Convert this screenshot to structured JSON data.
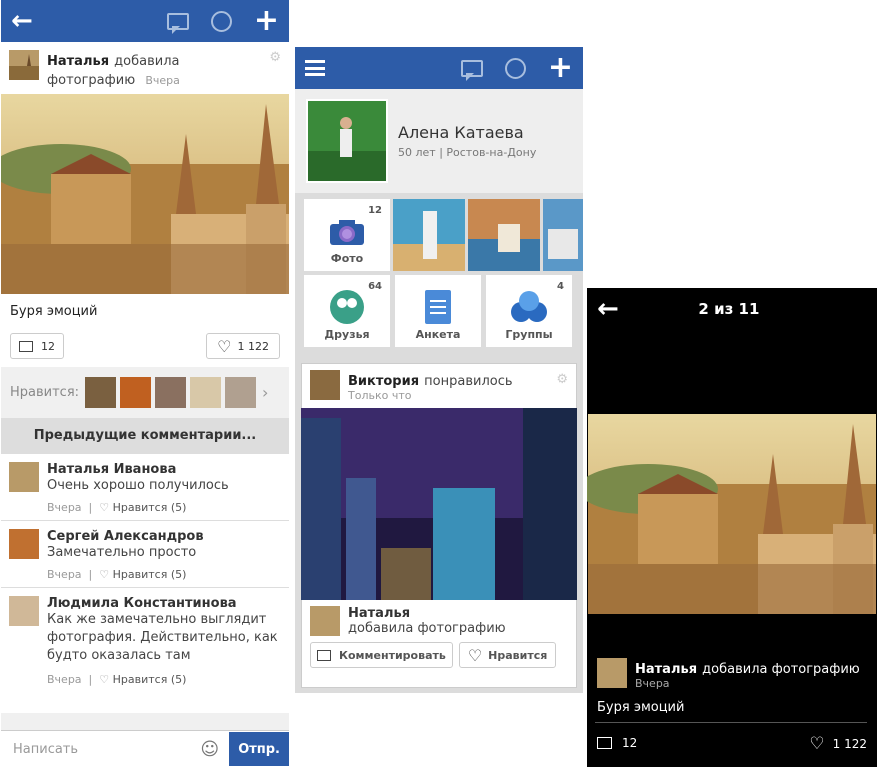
{
  "left": {
    "post": {
      "author": "Наталья",
      "action": "добавила",
      "action2": "фотографию",
      "time": "Вчера"
    },
    "caption": "Буря эмоций",
    "comment_count": "12",
    "likes": "1 122",
    "likes_label": "Нравится:",
    "prev_comments": "Предыдущие комментарии...",
    "comments": [
      {
        "name": "Наталья Иванова",
        "text": "Очень хорошо получилось",
        "time": "Вчера",
        "like": "Нравится (5)"
      },
      {
        "name": "Сергей Александров",
        "text": "Замечательно просто",
        "time": "Вчера",
        "like": "Нравится (5)"
      },
      {
        "name": "Людмила Константинова",
        "text": "Как же замечательно выглядит фотография. Действительно, как будто оказалась там",
        "time": "Вчера",
        "like": "Нравится (5)"
      }
    ],
    "input_placeholder": "Написать",
    "send": "Отпр."
  },
  "middle": {
    "profile": {
      "name": "Алена Катаева",
      "info": "50 лет | Ростов-на-Дону"
    },
    "tiles": {
      "photo": "Фото",
      "photo_count": "12",
      "friends": "Друзья",
      "friends_count": "64",
      "anketa": "Анкета",
      "groups": "Группы",
      "groups_count": "4"
    },
    "post": {
      "author": "Виктория",
      "action": "понравилось",
      "time": "Только что"
    },
    "sub": {
      "author": "Наталья",
      "action": "добавила фотографию"
    },
    "comment_btn": "Комментировать",
    "like_btn": "Нравится"
  },
  "right": {
    "counter": "2 из 11",
    "author": "Наталья",
    "action": "добавила фотографию",
    "time": "Вчера",
    "caption": "Буря эмоций",
    "comments": "12",
    "likes": "1 122"
  },
  "colors": {
    "topbar": "#2d5ca8",
    "send": "#2d5ca8"
  },
  "icons": [
    "back-arrow-icon",
    "chat-icon",
    "circle-icon",
    "plus-icon",
    "menu-icon",
    "heart-icon",
    "gear-icon",
    "smiley-icon",
    "camera-icon"
  ]
}
